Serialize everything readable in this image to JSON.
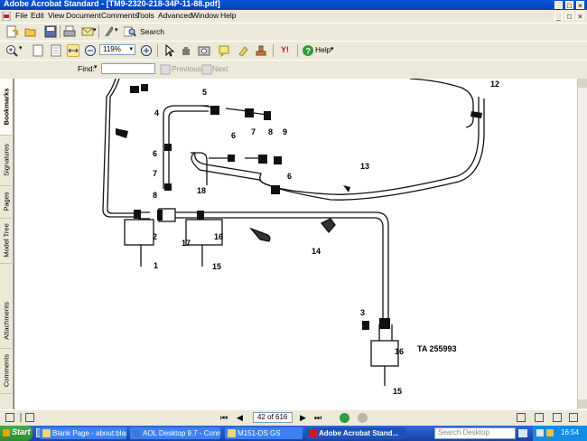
{
  "window": {
    "title": "Adobe Acrobat Standard - [TM9-2320-218-34P-11-88.pdf]",
    "min_label": "_",
    "max_label": "□",
    "close_label": "×"
  },
  "menubar": {
    "items": [
      "File",
      "Edit",
      "View",
      "Document",
      "Comments",
      "Tools",
      "Advanced",
      "Window",
      "Help"
    ],
    "doc_min_label": "_",
    "doc_max_label": "□",
    "doc_close_label": "×"
  },
  "toolbar": {
    "search_label": "Search",
    "zoom_value": "119%",
    "help_label": "Help",
    "yahoo_label": "Y!"
  },
  "findbar": {
    "find_label": "Find:",
    "find_value": "",
    "previous_label": "Previous",
    "next_label": "Next"
  },
  "sidetabs": [
    "Bookmarks",
    "Signatures",
    "Pages",
    "Model Tree",
    "Attachments",
    "Comments"
  ],
  "diagram": {
    "labels": [
      "1",
      "2",
      "3",
      "4",
      "5",
      "6",
      "6",
      "6",
      "7",
      "7",
      "8",
      "8",
      "9",
      "12",
      "13",
      "14",
      "15",
      "15",
      "16",
      "16",
      "17",
      "18"
    ],
    "ta_number": "TA 255993"
  },
  "statusbar": {
    "page_value": "42 of 616"
  },
  "taskbar": {
    "start_label": "Start",
    "tasks": [
      {
        "label": "Blank Page - about:blank"
      },
      {
        "label": "AOL Desktop 9.7 - Conn..."
      },
      {
        "label": "M151-DS GS"
      },
      {
        "label": "Adobe Acrobat Stand..."
      }
    ],
    "search_placeholder": "Search Desktop",
    "clock": "16:54"
  },
  "colors": {
    "titlebar": "#0a56d8",
    "chrome": "#ece9d8",
    "taskbar": "#245edb",
    "start_button": "#3a9a3a"
  }
}
